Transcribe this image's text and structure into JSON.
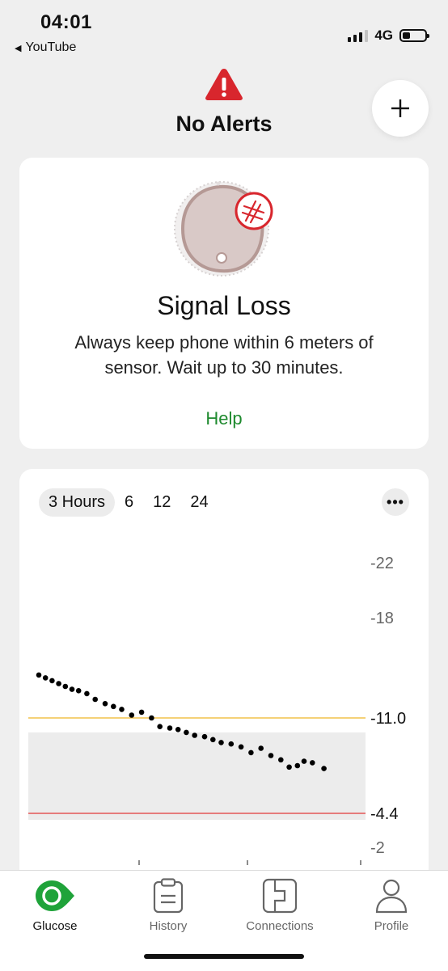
{
  "status_bar": {
    "time": "04:01",
    "back_app": "YouTube",
    "network": "4G",
    "battery_level": 0.35
  },
  "header": {
    "title": "No Alerts",
    "add_icon": "plus-icon",
    "alert_icon": "warning-triangle-icon"
  },
  "signal_card": {
    "title": "Signal Loss",
    "message": "Always keep phone within 6 meters of sensor. Wait up to 30 minutes.",
    "help_label": "Help",
    "sensor_icon": "sensor-signal-loss-icon"
  },
  "chart": {
    "tabs": [
      {
        "label": "3 Hours",
        "active": true
      },
      {
        "label": "6",
        "active": false
      },
      {
        "label": "12",
        "active": false
      },
      {
        "label": "24",
        "active": false
      }
    ],
    "more_icon": "more-horizontal-icon"
  },
  "chart_data": {
    "type": "scatter",
    "title": "",
    "xlabel": "",
    "ylabel": "",
    "x_range_hours": 3,
    "y_ticks": [
      2,
      4.4,
      11.0,
      18,
      22
    ],
    "y_tick_labels": [
      "2",
      "4.4",
      "11.0",
      "18",
      "22"
    ],
    "ylim": [
      2,
      22
    ],
    "high_threshold": 11.0,
    "low_threshold": 4.4,
    "target_range": [
      4.4,
      10.0
    ],
    "colors": {
      "high_line": "#f2c24a",
      "low_line": "#e35656",
      "target_band": "#ececec",
      "points": "#000000"
    },
    "points_x_fraction": [
      0.0,
      0.02,
      0.04,
      0.06,
      0.08,
      0.1,
      0.12,
      0.145,
      0.17,
      0.2,
      0.225,
      0.25,
      0.28,
      0.31,
      0.34,
      0.365,
      0.395,
      0.42,
      0.445,
      0.47,
      0.5,
      0.525,
      0.55,
      0.58,
      0.61,
      0.64,
      0.67,
      0.7,
      0.73,
      0.755,
      0.78,
      0.8,
      0.825,
      0.86
    ],
    "y": [
      14.0,
      13.8,
      13.6,
      13.4,
      13.2,
      13.0,
      12.9,
      12.7,
      12.3,
      12.0,
      11.8,
      11.6,
      11.2,
      11.4,
      11.0,
      10.4,
      10.3,
      10.2,
      10.0,
      9.8,
      9.7,
      9.5,
      9.3,
      9.2,
      9.0,
      8.6,
      8.9,
      8.4,
      8.1,
      7.6,
      7.7,
      8.0,
      7.9,
      7.5
    ]
  },
  "bottom_nav": {
    "items": [
      {
        "label": "Glucose",
        "icon": "glucose-drop-icon",
        "active": true
      },
      {
        "label": "History",
        "icon": "clipboard-icon",
        "active": false
      },
      {
        "label": "Connections",
        "icon": "sensor-connection-icon",
        "active": false
      },
      {
        "label": "Profile",
        "icon": "person-icon",
        "active": false
      }
    ]
  }
}
